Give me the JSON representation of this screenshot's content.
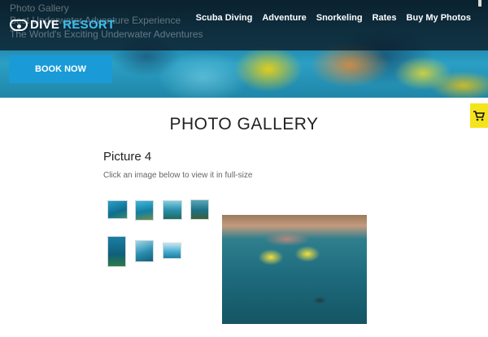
{
  "hero": {
    "ghost_lines": [
      "Photo Gallery",
      "Best Underwater Adventure Experience",
      "The World's Exciting Underwater Adventures"
    ]
  },
  "logo": {
    "word1": "DIVE",
    "word2": "RESORT",
    "icon": "diving-mask-icon"
  },
  "nav": {
    "items": [
      "Scuba Diving",
      "Adventure",
      "Snorkeling",
      "Rates",
      "Buy My Photos"
    ]
  },
  "book_button": "BOOK NOW",
  "cart": {
    "icon": "shopping-cart-icon"
  },
  "gallery": {
    "page_title": "PHOTO GALLERY",
    "picture_title": "Picture 4",
    "instructions": "Click an image below to view it in full-size"
  },
  "colors": {
    "accent": "#1a9bd7",
    "cart": "#f4e41c",
    "logo_accent": "#3fc0ef"
  }
}
